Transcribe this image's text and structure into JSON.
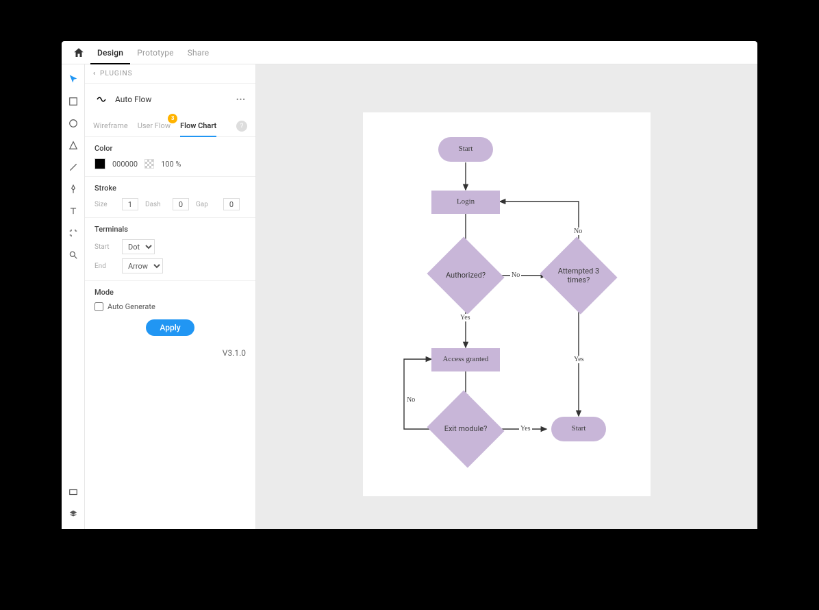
{
  "topbar": {
    "tabs": [
      "Design",
      "Prototype",
      "Share"
    ],
    "active": "Design"
  },
  "panel": {
    "header_back": "‹",
    "header_title": "PLUGINS",
    "plugin_name": "Auto Flow",
    "more": "•••",
    "tabs": {
      "wireframe": "Wireframe",
      "userflow": "User Flow",
      "flowchart": "Flow Chart",
      "badge": "3"
    },
    "color": {
      "title": "Color",
      "hex": "000000",
      "opacity": "100 %"
    },
    "stroke": {
      "title": "Stroke",
      "size_label": "Size",
      "size": "1",
      "dash_label": "Dash",
      "dash": "0",
      "gap_label": "Gap",
      "gap": "0"
    },
    "terminals": {
      "title": "Terminals",
      "start_label": "Start",
      "start": "Dot",
      "end_label": "End",
      "end": "Arrow"
    },
    "mode": {
      "title": "Mode",
      "autogen": "Auto Generate"
    },
    "apply": "Apply",
    "version": "V3.1.0"
  },
  "flowchart": {
    "start": "Start",
    "login": "Login",
    "authorized": "Authorized?",
    "attempted": "Attempted 3 times?",
    "access_granted": "Access granted",
    "exit_module": "Exit module?",
    "end": "Start",
    "yes": "Yes",
    "no": "No"
  }
}
